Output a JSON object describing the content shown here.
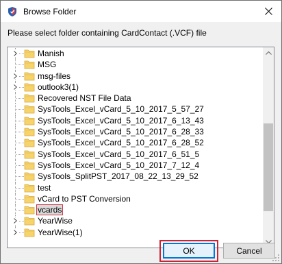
{
  "window": {
    "title": "Browse Folder",
    "close_glyph": "✕"
  },
  "instruction": "Please select folder containing CardContact (.VCF) file",
  "tree": {
    "items": [
      {
        "label": "Manish",
        "expandable": true,
        "selected": false
      },
      {
        "label": "MSG",
        "expandable": false,
        "selected": false
      },
      {
        "label": "msg-files",
        "expandable": true,
        "selected": false
      },
      {
        "label": "outlook3(1)",
        "expandable": true,
        "selected": false
      },
      {
        "label": "Recovered NST File Data",
        "expandable": false,
        "selected": false
      },
      {
        "label": "SysTools_Excel_vCard_5_10_2017_5_57_27",
        "expandable": false,
        "selected": false
      },
      {
        "label": "SysTools_Excel_vCard_5_10_2017_6_13_43",
        "expandable": false,
        "selected": false
      },
      {
        "label": "SysTools_Excel_vCard_5_10_2017_6_28_33",
        "expandable": false,
        "selected": false
      },
      {
        "label": "SysTools_Excel_vCard_5_10_2017_6_28_52",
        "expandable": false,
        "selected": false
      },
      {
        "label": "SysTools_Excel_vCard_5_10_2017_6_51_5",
        "expandable": false,
        "selected": false
      },
      {
        "label": "SysTools_Excel_vCard_5_10_2017_7_12_4",
        "expandable": false,
        "selected": false
      },
      {
        "label": "SysTools_SplitPST_2017_08_22_13_29_52",
        "expandable": false,
        "selected": false
      },
      {
        "label": "test",
        "expandable": false,
        "selected": false
      },
      {
        "label": "vCard to PST Conversion",
        "expandable": false,
        "selected": false
      },
      {
        "label": "vcards",
        "expandable": false,
        "selected": true
      },
      {
        "label": "YearWise",
        "expandable": true,
        "selected": false
      },
      {
        "label": "YearWise(1)",
        "expandable": true,
        "selected": false
      }
    ],
    "scroll_position": 0.72
  },
  "buttons": {
    "ok_label": "OK",
    "cancel_label": "Cancel"
  },
  "colors": {
    "highlight_red": "#cc2233",
    "folder_yellow": "#f6d36b",
    "focus_blue": "#0078d7"
  }
}
